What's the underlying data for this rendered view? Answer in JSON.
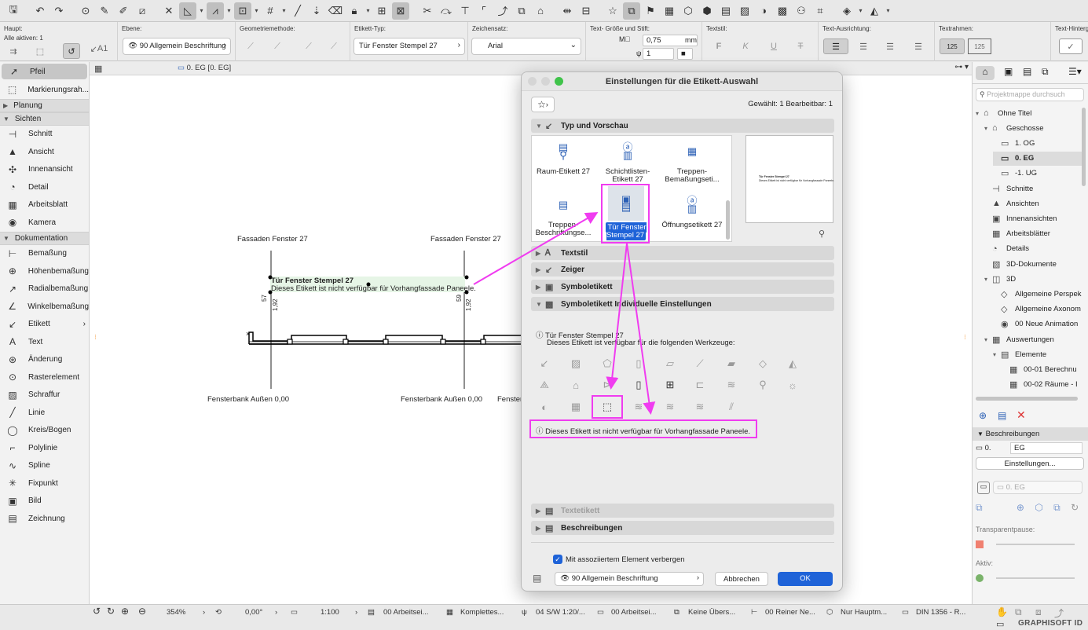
{
  "infobox": {
    "haupt_label": "Haupt:",
    "alle_aktiven": "Alle aktiven: 1",
    "ebene_label": "Ebene:",
    "ebene_value": "90 Allgemein Beschriftung",
    "geometrie_label": "Geometriemethode:",
    "etikett_typ_label": "Etikett-Typ:",
    "etikett_typ_value": "Tür Fenster Stempel 27",
    "zeichensatz_label": "Zeichensatz:",
    "zeichensatz_value": "Arial",
    "textgroesse_label": "Text- Größe und Stift:",
    "textgroesse_value": "0,75",
    "textgroesse_unit": "mm",
    "stift_value": "1",
    "textstil_label": "Textstil:",
    "textausrichtung_label": "Text-Ausrichtung:",
    "textrahmen_label": "Textrahmen:",
    "texthintergrund_label": "Text-Hinterg",
    "etikett_prefix": "A1"
  },
  "toolbox": {
    "items": [
      {
        "type": "tool",
        "icon": "arrow-icon",
        "glyph": "➚",
        "label": "Pfeil",
        "selected": true
      },
      {
        "type": "tool",
        "icon": "marquee-icon",
        "glyph": "⬚",
        "label": "Markierungsrah..."
      },
      {
        "type": "group",
        "label": "Planung",
        "open": false
      },
      {
        "type": "group",
        "label": "Sichten",
        "open": true
      },
      {
        "type": "tool",
        "icon": "section-icon",
        "glyph": "⊣",
        "label": "Schnitt"
      },
      {
        "type": "tool",
        "icon": "elevation-icon",
        "glyph": "▲",
        "label": "Ansicht"
      },
      {
        "type": "tool",
        "icon": "interior-elevation-icon",
        "glyph": "✣",
        "label": "Innenansicht"
      },
      {
        "type": "tool",
        "icon": "detail-icon",
        "glyph": "◔",
        "label": "Detail"
      },
      {
        "type": "tool",
        "icon": "worksheet-icon",
        "glyph": "▦",
        "label": "Arbeitsblatt"
      },
      {
        "type": "tool",
        "icon": "camera-icon",
        "glyph": "◉",
        "label": "Kamera"
      },
      {
        "type": "group",
        "label": "Dokumentation",
        "open": true
      },
      {
        "type": "tool",
        "icon": "dimension-icon",
        "glyph": "⊢",
        "label": "Bemaßung"
      },
      {
        "type": "tool",
        "icon": "level-dimension-icon",
        "glyph": "⊕",
        "label": "Höhenbemaßung"
      },
      {
        "type": "tool",
        "icon": "radial-dimension-icon",
        "glyph": "↗",
        "label": "Radialbemaßung"
      },
      {
        "type": "tool",
        "icon": "angle-dimension-icon",
        "glyph": "∠",
        "label": "Winkelbemaßung"
      },
      {
        "type": "tool",
        "icon": "label-icon",
        "glyph": "↙",
        "label": "Etikett",
        "more": true
      },
      {
        "type": "tool",
        "icon": "text-icon",
        "glyph": "A",
        "label": "Text"
      },
      {
        "type": "tool",
        "icon": "change-icon",
        "glyph": "⊛",
        "label": "Änderung"
      },
      {
        "type": "tool",
        "icon": "grid-element-icon",
        "glyph": "⊙",
        "label": "Rasterelement"
      },
      {
        "type": "tool",
        "icon": "fill-icon",
        "glyph": "▨",
        "label": "Schraffur"
      },
      {
        "type": "tool",
        "icon": "line-icon",
        "glyph": "╱",
        "label": "Linie"
      },
      {
        "type": "tool",
        "icon": "arc-icon",
        "glyph": "◯",
        "label": "Kreis/Bogen"
      },
      {
        "type": "tool",
        "icon": "polyline-icon",
        "glyph": "⌐",
        "label": "Polylinie"
      },
      {
        "type": "tool",
        "icon": "spline-icon",
        "glyph": "∿",
        "label": "Spline"
      },
      {
        "type": "tool",
        "icon": "hotspot-icon",
        "glyph": "✳",
        "label": "Fixpunkt"
      },
      {
        "type": "tool",
        "icon": "figure-icon",
        "glyph": "▣",
        "label": "Bild"
      },
      {
        "type": "tool",
        "icon": "drawing-icon",
        "glyph": "▤",
        "label": "Zeichnung"
      }
    ]
  },
  "canvas": {
    "tab_label": "0. EG [0. EG]",
    "fassade_1": "Fassaden Fenster 27",
    "fassade_2": "Fassaden Fenster 27",
    "stamp_title": "Tür Fenster Stempel 27",
    "stamp_text": "Dieses Etikett ist nicht verfügbar für Vorhangfassade Paneele.",
    "dim_57": "57",
    "dim_192a": "1,92",
    "dim_59": "59",
    "dim_192b": "1,92",
    "bank_1": "Fensterbank Außen 0,00",
    "bank_2": "Fensterbank Außen 0,00",
    "bank_3": "Fenster"
  },
  "dialog": {
    "title": "Einstellungen für die Etikett-Auswahl",
    "selection_info": "Gewählt: 1 Bearbeitbar: 1",
    "sections": {
      "typ": "Typ und Vorschau",
      "textstil": "Textstil",
      "zeiger": "Zeiger",
      "symboletikett": "Symboletikett",
      "individuell": "Symboletikett Individuelle Einstellungen",
      "textetikett": "Textetikett",
      "beschreibungen": "Beschreibungen"
    },
    "thumbnails": [
      {
        "label": "Raum-Etikett 27"
      },
      {
        "label": "Schichtlisten-Etikett 27"
      },
      {
        "label": "Treppen-Bemaßungseti..."
      },
      {
        "label": "Treppen-Beschriftungse..."
      },
      {
        "label": "Tür Fenster Stempel 27",
        "selected": true
      },
      {
        "label": "Öffnungsetikett 27"
      }
    ],
    "preview_title": "Tür Fenster Stempel 27",
    "preview_text": "Dieses Etikett ist nicht verfügbar für Vorhangfassade Paneele.",
    "info_title": "Tür Fenster Stempel 27",
    "info_text": "Dieses Etikett ist verfügbar für die folgenden Werkzeuge:",
    "warning_text": "Dieses Etikett ist nicht verfügbar für Vorhangfassade Paneele.",
    "hide_checkbox_label": "Mit assoziiertem Element verbergen",
    "layer_value": "90 Allgemein Beschriftung",
    "cancel_label": "Abbrechen",
    "ok_label": "OK"
  },
  "navigator": {
    "search_placeholder": "Projektmappe durchsuch",
    "tree": [
      {
        "label": "Ohne Titel",
        "level": 0,
        "toggle": "▾",
        "icon": "⌂",
        "iconName": "project-icon"
      },
      {
        "label": "Geschosse",
        "level": 1,
        "toggle": "▾",
        "icon": "⌂",
        "iconName": "stories-icon"
      },
      {
        "label": "1. OG",
        "level": 2,
        "toggle": "",
        "icon": "▭",
        "iconName": "story-icon"
      },
      {
        "label": "0. EG",
        "level": 2,
        "toggle": "",
        "icon": "▭",
        "iconName": "story-icon",
        "selected": true
      },
      {
        "label": "-1. UG",
        "level": 2,
        "toggle": "",
        "icon": "▭",
        "iconName": "story-icon"
      },
      {
        "label": "Schnitte",
        "level": 1,
        "toggle": "",
        "icon": "⊣",
        "iconName": "sections-icon"
      },
      {
        "label": "Ansichten",
        "level": 1,
        "toggle": "",
        "icon": "▲",
        "iconName": "elevations-icon"
      },
      {
        "label": "Innenansichten",
        "level": 1,
        "toggle": "",
        "icon": "▣",
        "iconName": "interior-elevations-icon"
      },
      {
        "label": "Arbeitsblätter",
        "level": 1,
        "toggle": "",
        "icon": "▦",
        "iconName": "worksheets-icon"
      },
      {
        "label": "Details",
        "level": 1,
        "toggle": "",
        "icon": "◔",
        "iconName": "details-icon"
      },
      {
        "label": "3D-Dokumente",
        "level": 1,
        "toggle": "",
        "icon": "▧",
        "iconName": "3d-documents-icon"
      },
      {
        "label": "3D",
        "level": 1,
        "toggle": "▾",
        "icon": "◫",
        "iconName": "3d-icon"
      },
      {
        "label": "Allgemeine Perspek",
        "level": 2,
        "toggle": "",
        "icon": "◇",
        "iconName": "perspective-icon"
      },
      {
        "label": "Allgemeine Axonom",
        "level": 2,
        "toggle": "",
        "icon": "◇",
        "iconName": "axonometry-icon"
      },
      {
        "label": "00 Neue Animation",
        "level": 2,
        "toggle": "",
        "icon": "◉",
        "iconName": "animation-icon"
      },
      {
        "label": "Auswertungen",
        "level": 1,
        "toggle": "▾",
        "icon": "▦",
        "iconName": "schedules-icon"
      },
      {
        "label": "Elemente",
        "level": 2,
        "toggle": "▾",
        "icon": "▤",
        "iconName": "elements-icon"
      },
      {
        "label": "00-01 Berechnu",
        "level": 3,
        "toggle": "",
        "icon": "▦",
        "iconName": "schedule-icon"
      },
      {
        "label": "00-02 Räume - I",
        "level": 3,
        "toggle": "",
        "icon": "▦",
        "iconName": "schedule-icon"
      }
    ],
    "beschreibungen_label": "Beschreibungen",
    "story_number": "0.",
    "story_name": "EG",
    "settings_button": "Einstellungen...",
    "story_field": "0. EG",
    "transparentpause_label": "Transparentpause:",
    "aktiv_label": "Aktiv:"
  },
  "statusbar": {
    "zoom": "354%",
    "angle": "0,00°",
    "scale": "1:100",
    "layer_combo": "00 Arbeitsei...",
    "model_view": "Komplettes...",
    "pen_set": "04 S/W 1:20/...",
    "graphic_override": "00 Arbeitsei...",
    "renovation": "Keine Übers...",
    "dimension": "00 Reiner Ne...",
    "structure": "Nur Hauptm...",
    "paper": "DIN 1356 - R...",
    "brand": "GRAPHISOFT ID"
  },
  "colors": {
    "accent": "#1f63d8",
    "annotation": "#f03cf0",
    "stamp_bg": "#e6f5e6"
  }
}
